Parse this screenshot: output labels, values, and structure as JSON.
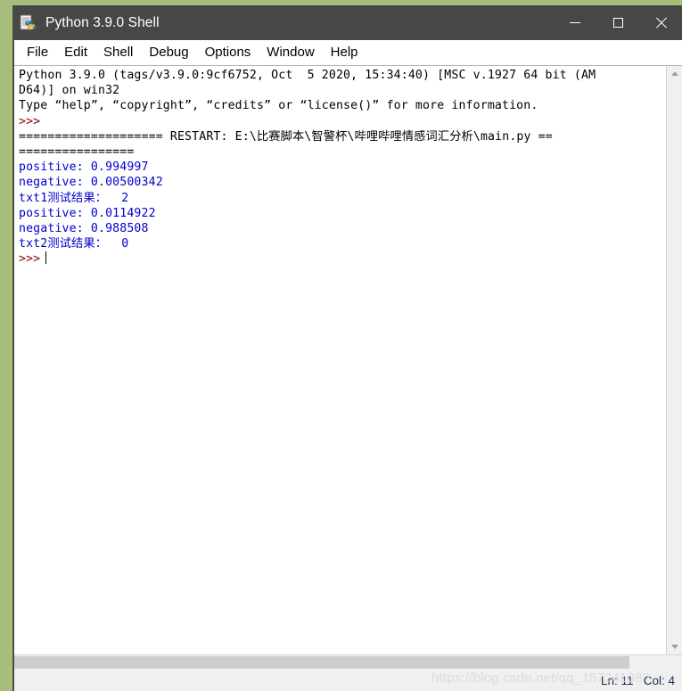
{
  "window": {
    "title": "Python 3.9.0 Shell",
    "icon": "idle-python-icon",
    "titlebar_color": "#474746",
    "desktop_color": "#a6bd7c",
    "controls": {
      "minimize": "minimize-icon",
      "maximize": "maximize-icon",
      "close": "close-icon"
    }
  },
  "menubar": {
    "items": [
      {
        "label": "File"
      },
      {
        "label": "Edit"
      },
      {
        "label": "Shell"
      },
      {
        "label": "Debug"
      },
      {
        "label": "Options"
      },
      {
        "label": "Window"
      },
      {
        "label": "Help"
      }
    ]
  },
  "console": {
    "colors": {
      "stdout": "#000000",
      "output_blue": "#0000cd",
      "prompt_red": "#8b0000",
      "background": "#ffffff"
    },
    "lines": [
      {
        "color": "black",
        "text": "Python 3.9.0 (tags/v3.9.0:9cf6752, Oct  5 2020, 15:34:40) [MSC v.1927 64 bit (AM"
      },
      {
        "color": "black",
        "text": "D64)] on win32"
      },
      {
        "color": "black",
        "text": "Type “help”, “copyright”, “credits” or “license()” for more information."
      },
      {
        "color": "red",
        "text": ">>>"
      },
      {
        "color": "black",
        "text": "==================== RESTART: E:\\比赛脚本\\智警杯\\哔哩哔哩情感词汇分析\\main.py =="
      },
      {
        "color": "black",
        "text": "================"
      },
      {
        "color": "blue",
        "text": "positive: 0.994997"
      },
      {
        "color": "blue",
        "text": "negative: 0.00500342"
      },
      {
        "color": "blue",
        "text": "txt1测试结果：  2"
      },
      {
        "color": "blue",
        "text": "positive: 0.0114922"
      },
      {
        "color": "blue",
        "text": "negative: 0.988508"
      },
      {
        "color": "blue",
        "text": "txt2测试结果：  0"
      },
      {
        "color": "red",
        "text": ">>>",
        "caret": true
      }
    ]
  },
  "scrollbars": {
    "vertical": {
      "up_arrow": "chevron-up-icon",
      "down_arrow": "chevron-down-icon"
    },
    "horizontal": {
      "visible": true
    }
  },
  "statusbar": {
    "line_label": "Ln: 11",
    "col_label": "Col: 4",
    "text": "Ln: 11   Col: 4",
    "watermark": "https://blog.csdn.net/qq_18724138?"
  }
}
